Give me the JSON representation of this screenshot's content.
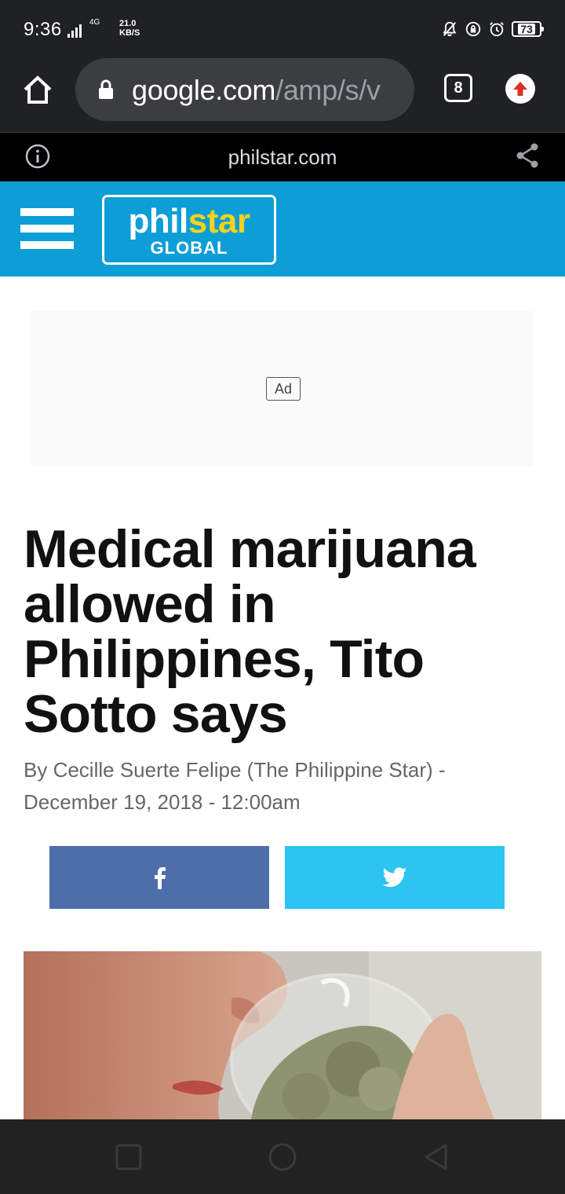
{
  "status_bar": {
    "time": "9:36",
    "network": "4G",
    "speed_value": "21.0",
    "speed_unit": "KB/S",
    "battery": "73"
  },
  "browser": {
    "url_host": "google.com",
    "url_path": "/amp/s/v",
    "tab_count": "8"
  },
  "amp_bar": {
    "domain": "philstar.com"
  },
  "site": {
    "logo_phil": "phil",
    "logo_star": "star",
    "logo_global": "GLOBAL",
    "colors": {
      "header": "#0d9ed8",
      "logo_accent": "#f7d318"
    }
  },
  "ad": {
    "label": "Ad"
  },
  "article": {
    "headline": "Medical marijuana allowed in Philippines, Tito Sotto says",
    "byline": "By  Cecille Suerte Felipe (The Philippine Star) - December 19, 2018 - 12:00am"
  },
  "share": {
    "facebook_icon": "facebook-icon",
    "twitter_icon": "twitter-icon",
    "colors": {
      "facebook": "#4e6eaa",
      "twitter": "#2cc4f1"
    }
  },
  "nav": {
    "recents_icon": "square-icon",
    "home_icon": "circle-icon",
    "back_icon": "triangle-back-icon"
  }
}
